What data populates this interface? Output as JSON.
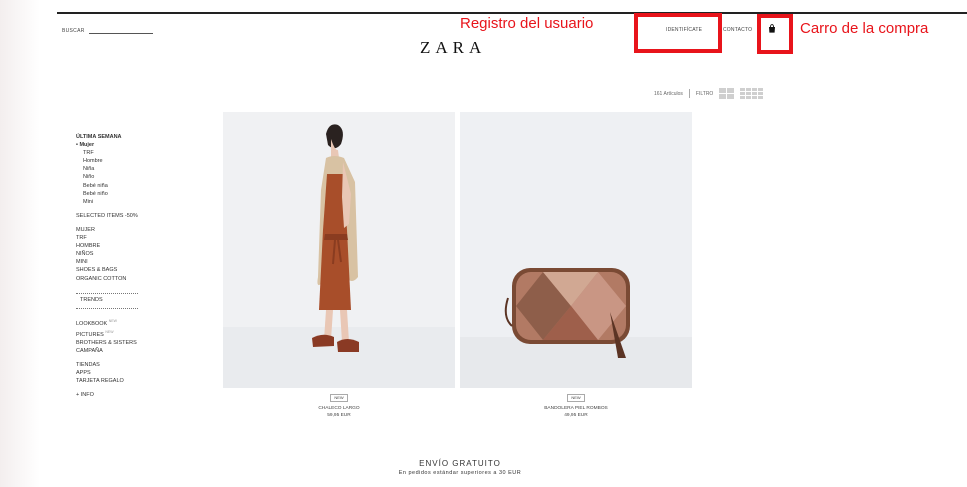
{
  "header": {
    "search_label": "BUSCAR",
    "logo": "ZARA",
    "identificate": "IDENTIFÍCATE",
    "contacto": "CONTACTO",
    "cart_icon": "bag-icon"
  },
  "annotations": {
    "registro": "Registro del usuario",
    "carro": "Carro de la compra",
    "color": "#e8141b"
  },
  "toolbar": {
    "count": "161 Artículos",
    "filtro": "FILTRO"
  },
  "sidebar": {
    "heading": "ÚLTIMA SEMANA",
    "active": "• Mujer",
    "sub": [
      "TRF",
      "Hombre",
      "Niña",
      "Niño",
      "Bebé niña",
      "Bebé niño",
      "Mini"
    ],
    "selected": "SELECTED ITEMS -50%",
    "sections": [
      "MUJER",
      "TRF",
      "HOMBRE",
      "NIÑOS",
      "MINI",
      "SHOES & BAGS",
      "ORGANIC COTTON"
    ],
    "trends": "TRENDS",
    "lookbook": "LOOKBOOK",
    "pictures": "PICTURES",
    "new_tag": "NEW",
    "brothers": "BROTHERS & SISTERS",
    "campana": "CAMPAÑA",
    "tiendas": "TIENDAS",
    "apps": "APPS",
    "tarjeta": "TARJETA REGALO",
    "info": "+ INFO"
  },
  "products": [
    {
      "badge": "NEW",
      "name": "CHALECO LARGO",
      "price": "59,95 EUR"
    },
    {
      "badge": "NEW",
      "name": "BANDOLERA PIEL ROMBOS",
      "price": "49,95 EUR"
    }
  ],
  "shipping": {
    "title": "ENVÍO GRATUITO",
    "subtitle": "En pedidos estándar superiores a 30 EUR"
  }
}
